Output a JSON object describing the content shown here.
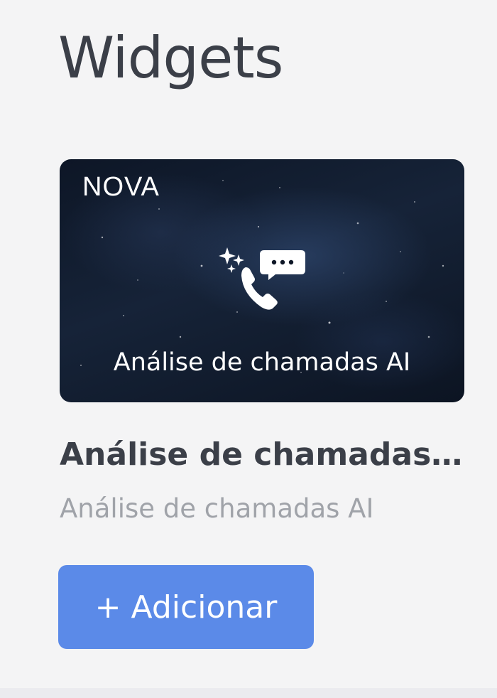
{
  "section": {
    "title": "Widgets"
  },
  "widget": {
    "banner": {
      "brand": "NOVA",
      "icon": "ai-call-analysis-icon",
      "caption": "Análise de chamadas AI"
    },
    "name": "Análise de chamadas AI",
    "description": "Análise de chamadas AI",
    "add_button": {
      "icon": "+",
      "label": "Adicionar"
    }
  },
  "colors": {
    "background": "#f4f4f5",
    "title_text": "#3b3f48",
    "muted_text": "#a0a3a9",
    "button_bg": "#5b8ae8",
    "banner_bg": "#0d1626"
  }
}
